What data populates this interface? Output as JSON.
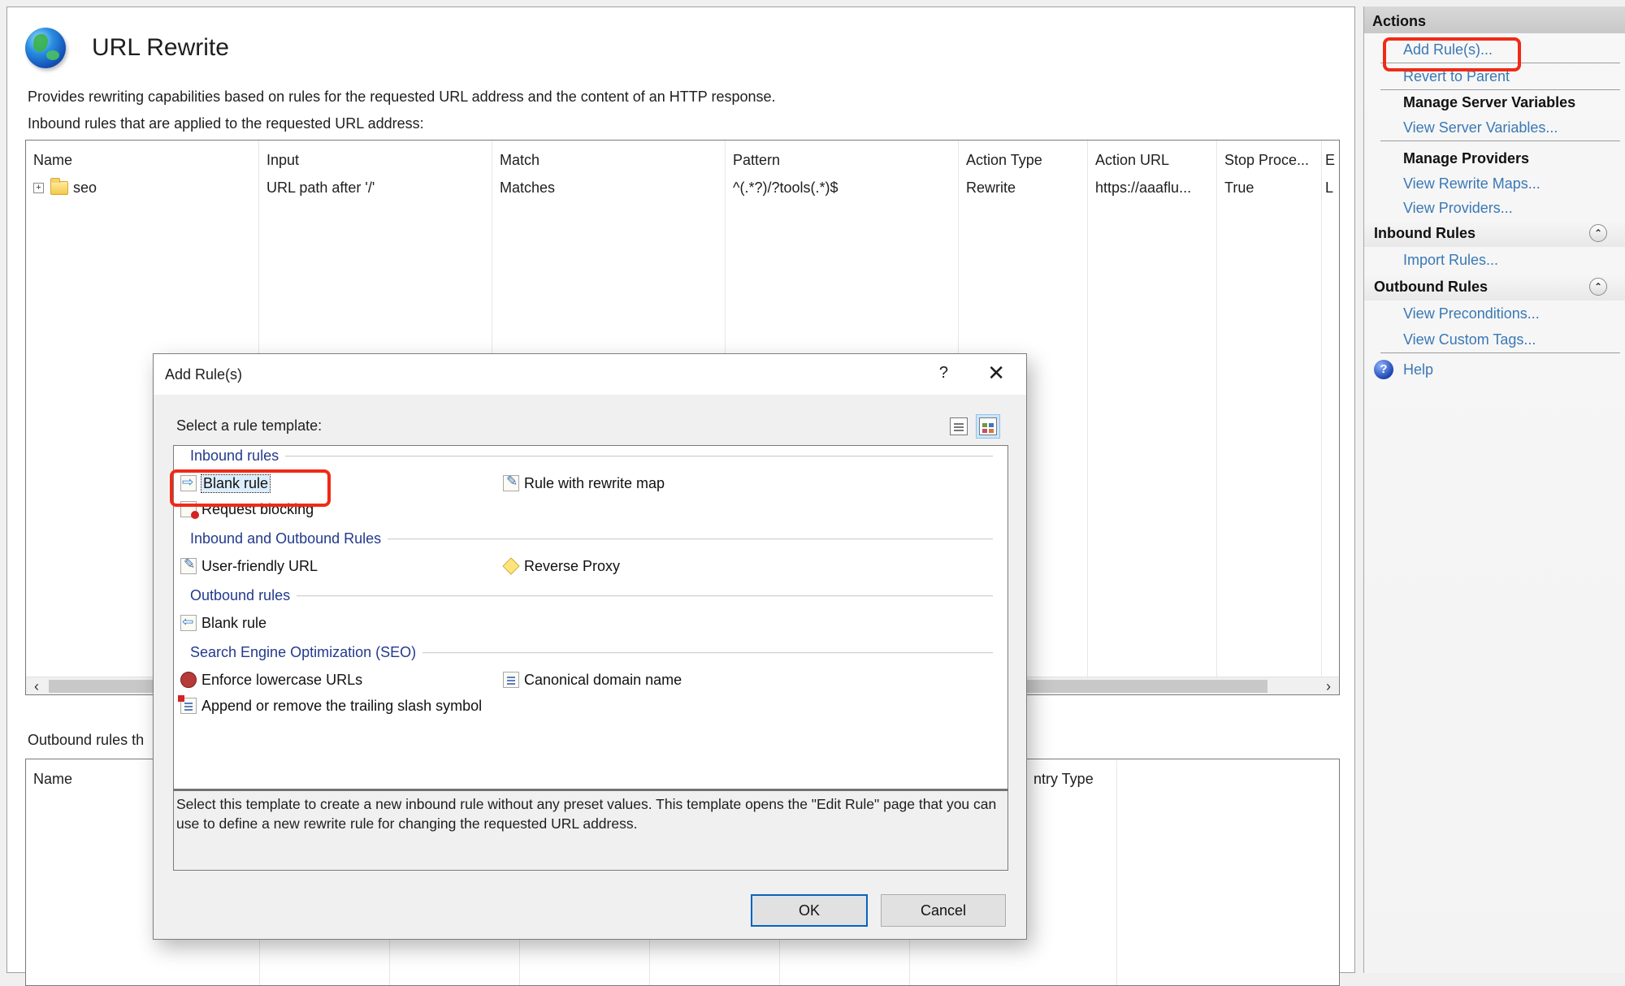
{
  "page": {
    "title": "URL Rewrite",
    "description": "Provides rewriting capabilities based on rules for the requested URL address and the content of an HTTP response.",
    "inbound_label": "Inbound rules that are applied to the requested URL address:",
    "outbound_label": "Outbound rules th"
  },
  "inbound_table": {
    "columns": [
      "Name",
      "Input",
      "Match",
      "Pattern",
      "Action Type",
      "Action URL",
      "Stop Proce...",
      "E"
    ],
    "rows": [
      {
        "expander": "+",
        "name": "seo",
        "input": "URL path after '/'",
        "match": "Matches",
        "pattern": "^(.*?)/?tools(.*)$",
        "action_type": "Rewrite",
        "action_url": "https://aaaflu...",
        "stop_processing": "True",
        "extra": "L"
      }
    ],
    "scroll_left": "‹",
    "scroll_right": "›"
  },
  "outbound_table": {
    "columns": [
      "Name",
      "ntry Type"
    ]
  },
  "actions": {
    "header": "Actions",
    "add_rules": "Add Rule(s)...",
    "revert": "Revert to Parent",
    "manage_server_vars": "Manage Server Variables",
    "view_server_vars": "View Server Variables...",
    "manage_providers": "Manage Providers",
    "view_rewrite_maps": "View Rewrite Maps...",
    "view_providers": "View Providers...",
    "inbound_group": "Inbound Rules",
    "import_rules": "Import Rules...",
    "outbound_group": "Outbound Rules",
    "view_preconditions": "View Preconditions...",
    "view_custom_tags": "View Custom Tags...",
    "help": "Help",
    "collapse_glyph": "⌃",
    "help_glyph": "?"
  },
  "dialog": {
    "title": "Add Rule(s)",
    "help_glyph": "?",
    "close_glyph": "✕",
    "prompt": "Select a rule template:",
    "sections": {
      "inbound": "Inbound rules",
      "in_out": "Inbound and Outbound Rules",
      "outbound": "Outbound rules",
      "seo": "Search Engine Optimization (SEO)"
    },
    "templates": {
      "blank_inbound": "Blank rule",
      "rewrite_map": "Rule with rewrite map",
      "request_blocking": "Request blocking",
      "user_friendly": "User-friendly URL",
      "reverse_proxy": "Reverse Proxy",
      "blank_outbound": "Blank rule",
      "lowercase": "Enforce lowercase URLs",
      "canonical": "Canonical domain name",
      "trailing_slash": "Append or remove the trailing slash symbol"
    },
    "selected_template": "Blank rule",
    "description": "Select this template to create a new inbound rule without any preset values. This template opens the \"Edit Rule\" page that you can use to define a new rewrite rule for changing the requested URL address.",
    "ok": "OK",
    "cancel": "Cancel"
  },
  "colors": {
    "link": "#3a78b5",
    "section_heading": "#233a8c",
    "highlight_box": "#f02a17",
    "ok_border": "#0b63b6"
  }
}
